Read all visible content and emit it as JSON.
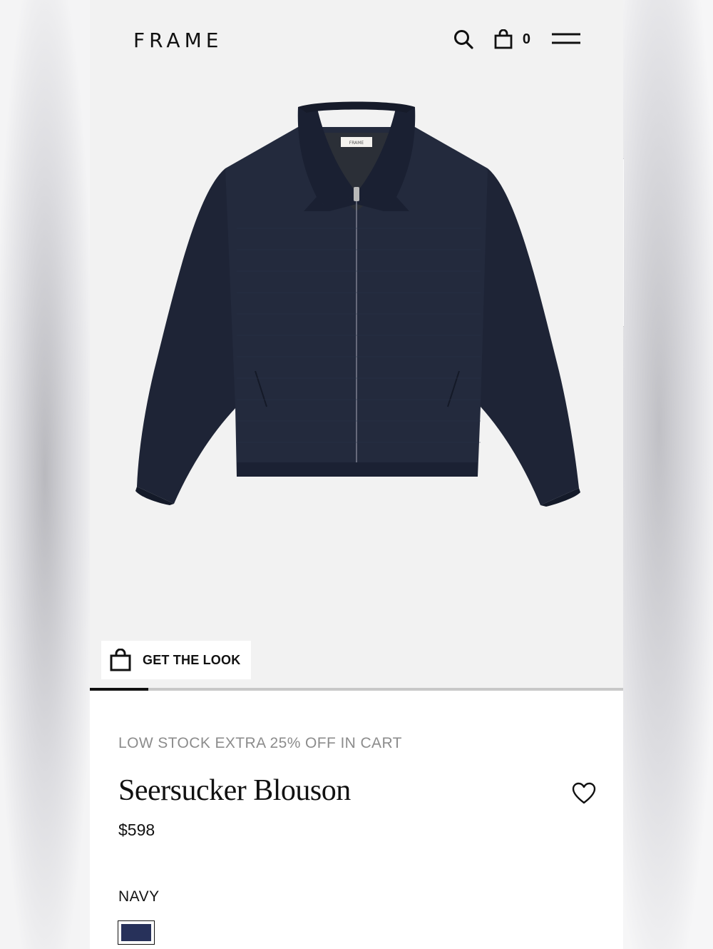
{
  "header": {
    "logo": "FRAME",
    "search_icon": "search-icon",
    "bag_icon": "shopping-bag-icon",
    "cart_count": "0",
    "menu_icon": "hamburger-menu-icon"
  },
  "hero": {
    "image": "navy zip-up blouson jacket product photo",
    "get_the_look_label": "GET THE LOOK",
    "gallery_progress": 0.11
  },
  "product": {
    "promo": "LOW STOCK EXTRA 25% OFF IN CART",
    "name": "Seersucker Blouson",
    "price": "$598",
    "color_label": "NAVY",
    "swatch_color": "#27315a",
    "wishlist_icon": "heart-icon"
  },
  "colors": {
    "jacket": "#1e2436",
    "background": "#f2f2f2",
    "text": "#111111",
    "promo_text": "#8c8c8c"
  }
}
